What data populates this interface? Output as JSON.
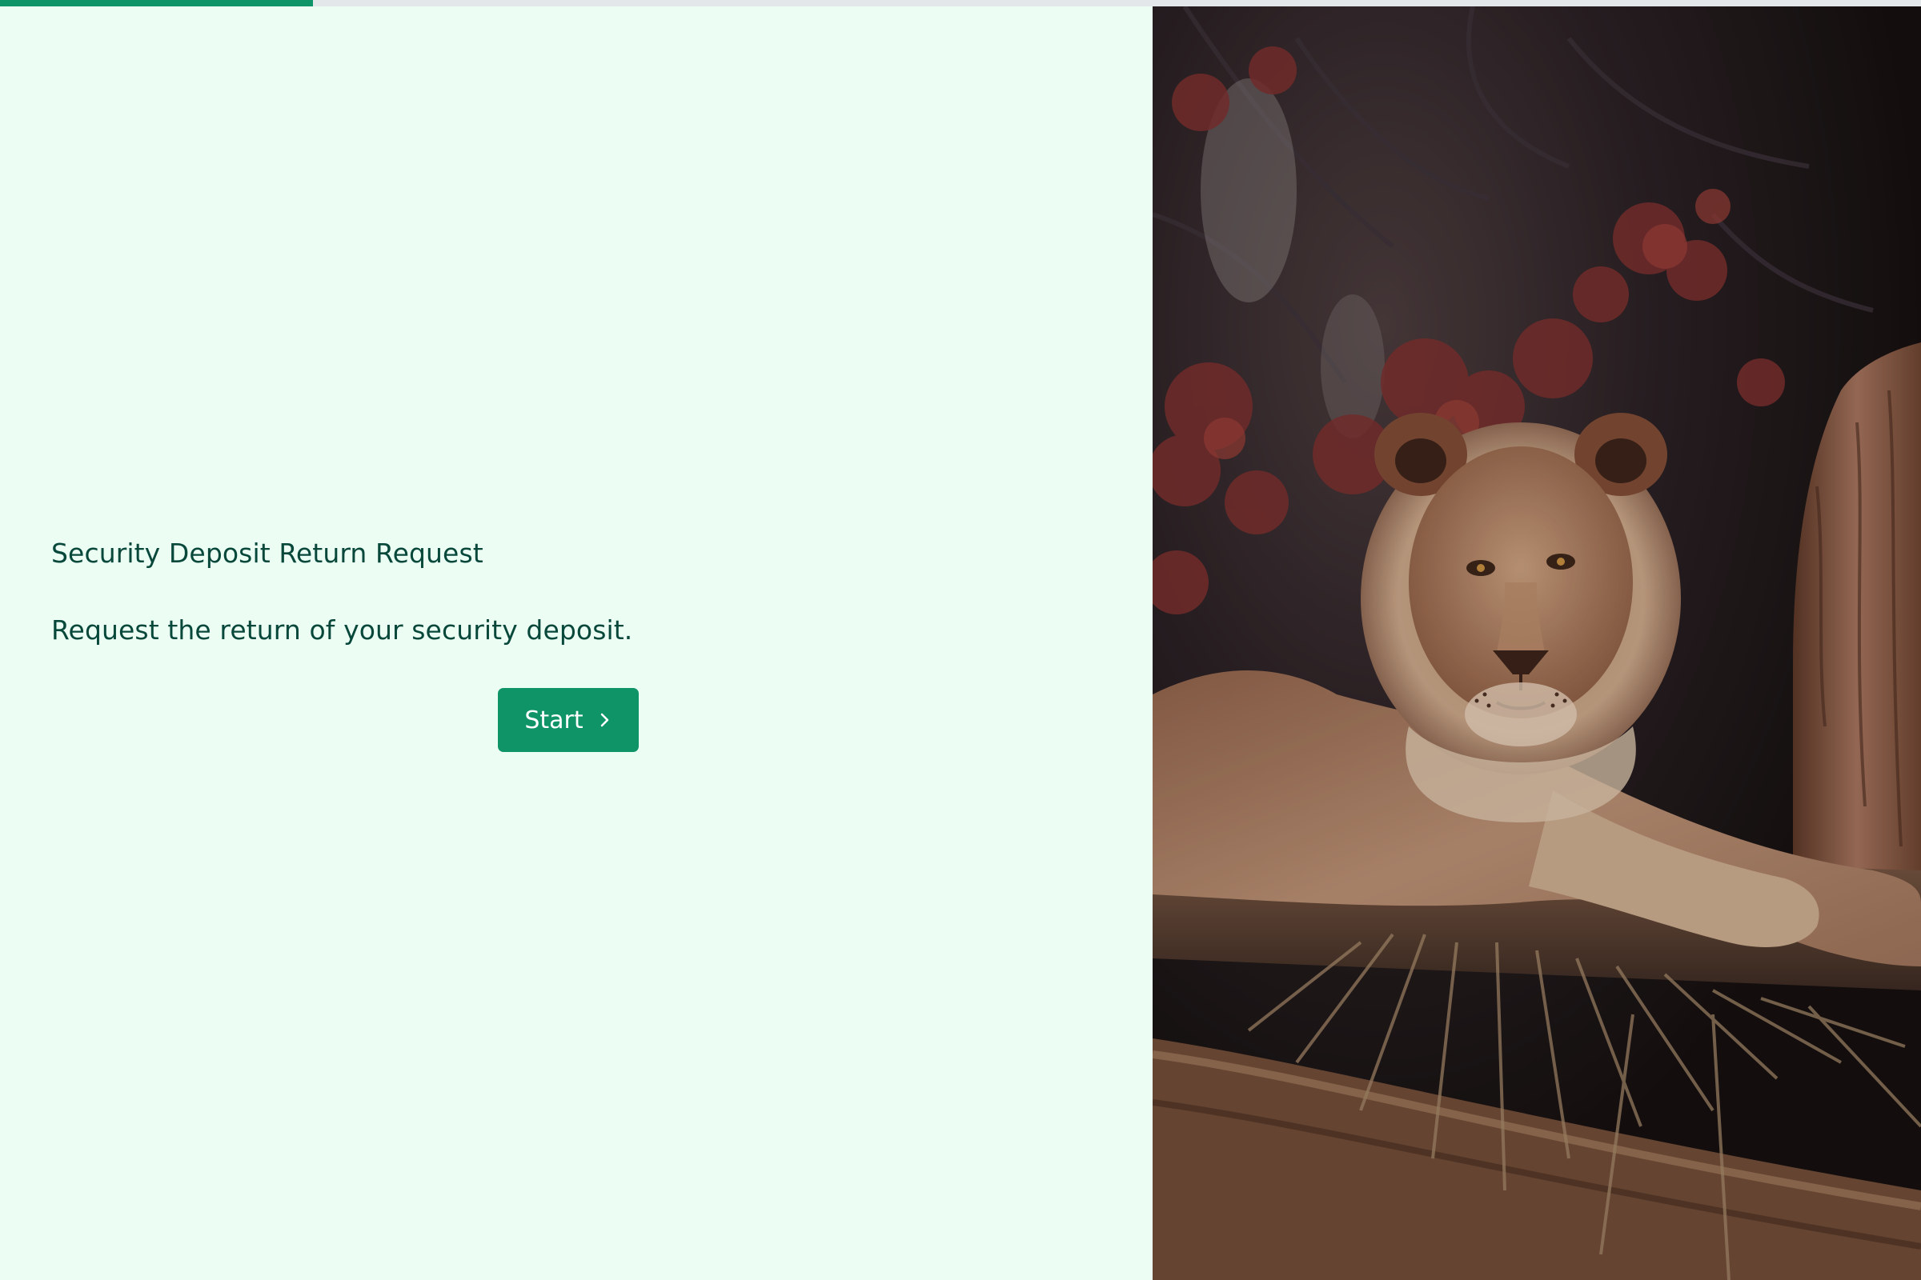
{
  "progress": {
    "fraction": 0.163,
    "track_color": "#e4e7ea",
    "fill_color": "#0e9466"
  },
  "form": {
    "title": "Security Deposit Return Request",
    "description": "Request the return of your security deposit.",
    "start_button": {
      "label": "Start",
      "icon": "chevron-right-icon"
    }
  },
  "cover_image": {
    "subject": "lion-photo"
  },
  "colors": {
    "background": "#ecfdf4",
    "text": "#07483a",
    "accent": "#0e9466"
  }
}
